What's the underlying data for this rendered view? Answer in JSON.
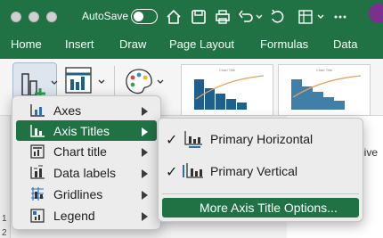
{
  "titlebar": {
    "autosave_label": "AutoSave"
  },
  "tabs": [
    "Home",
    "Insert",
    "Draw",
    "Page Layout",
    "Formulas",
    "Data"
  ],
  "ribbon": {
    "chart_thumb_caption": "Chart Title"
  },
  "sheet": {
    "partial_text": "eive",
    "row_numbers": [
      "1",
      "2"
    ]
  },
  "chart_element_menu": {
    "items": [
      {
        "label": "Axes",
        "icon": "axes-icon"
      },
      {
        "label": "Axis Titles",
        "icon": "axis-titles-icon"
      },
      {
        "label": "Chart title",
        "icon": "chart-title-icon"
      },
      {
        "label": "Data labels",
        "icon": "data-labels-icon"
      },
      {
        "label": "Gridlines",
        "icon": "gridlines-icon"
      },
      {
        "label": "Legend",
        "icon": "legend-icon"
      }
    ]
  },
  "axis_titles_submenu": {
    "items": [
      {
        "label": "Primary Horizontal",
        "checked": true
      },
      {
        "label": "Primary Vertical",
        "checked": true
      }
    ],
    "more_label": "More Axis Title Options..."
  },
  "colors": {
    "accent_green": "#207245",
    "chart_blue": "#1f5f8b",
    "pareto_orange": "#e8a15a"
  }
}
